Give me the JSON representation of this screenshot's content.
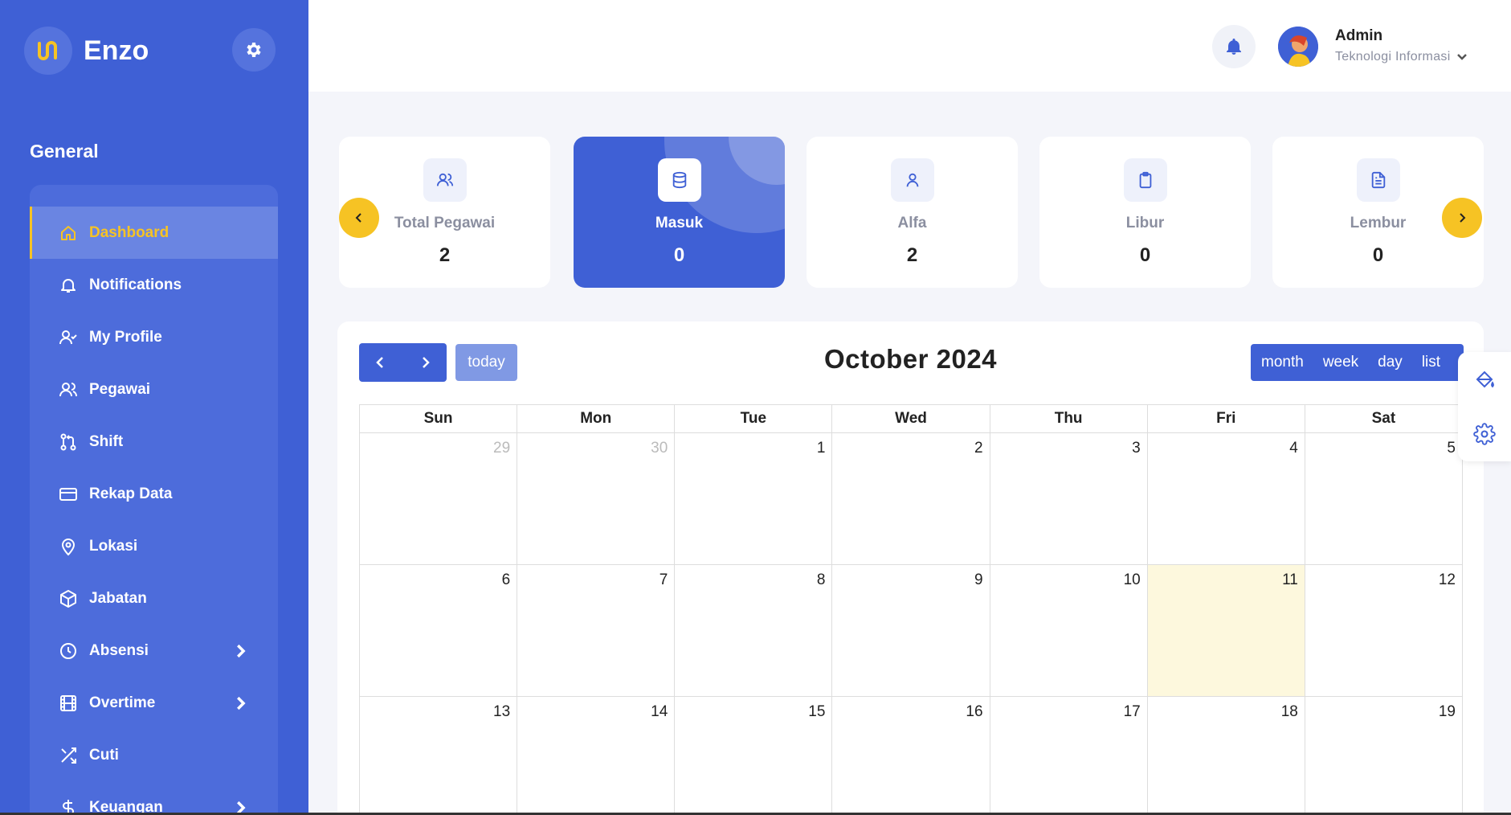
{
  "brand": {
    "name": "Enzo"
  },
  "sidebar": {
    "section_title": "General",
    "items": [
      {
        "label": "Dashboard",
        "icon": "home-icon",
        "active": true
      },
      {
        "label": "Notifications",
        "icon": "bell-icon"
      },
      {
        "label": "My Profile",
        "icon": "user-check-icon"
      },
      {
        "label": "Pegawai",
        "icon": "users-icon"
      },
      {
        "label": "Shift",
        "icon": "git-pull-icon"
      },
      {
        "label": "Rekap Data",
        "icon": "credit-card-icon"
      },
      {
        "label": "Lokasi",
        "icon": "map-pin-icon"
      },
      {
        "label": "Jabatan",
        "icon": "box-icon"
      },
      {
        "label": "Absensi",
        "icon": "clock-icon",
        "has_submenu": true
      },
      {
        "label": "Overtime",
        "icon": "film-icon",
        "has_submenu": true
      },
      {
        "label": "Cuti",
        "icon": "shuffle-icon"
      },
      {
        "label": "Keuangan",
        "icon": "dollar-icon",
        "has_submenu": true
      }
    ]
  },
  "header": {
    "user_name": "Admin",
    "user_dept": "Teknologi Informasi"
  },
  "stats": [
    {
      "label": "Total Pegawai",
      "value": "2",
      "icon": "users-icon"
    },
    {
      "label": "Masuk",
      "value": "0",
      "icon": "database-icon",
      "active": true
    },
    {
      "label": "Alfa",
      "value": "2",
      "icon": "user-icon"
    },
    {
      "label": "Libur",
      "value": "0",
      "icon": "clipboard-icon"
    },
    {
      "label": "Lembur",
      "value": "0",
      "icon": "file-text-icon"
    }
  ],
  "calendar": {
    "title": "October 2024",
    "today_label": "today",
    "views": [
      "month",
      "week",
      "day",
      "list"
    ],
    "weekdays": [
      "Sun",
      "Mon",
      "Tue",
      "Wed",
      "Thu",
      "Fri",
      "Sat"
    ],
    "weeks": [
      [
        {
          "d": "29",
          "other": true
        },
        {
          "d": "30",
          "other": true
        },
        {
          "d": "1"
        },
        {
          "d": "2"
        },
        {
          "d": "3"
        },
        {
          "d": "4"
        },
        {
          "d": "5"
        }
      ],
      [
        {
          "d": "6"
        },
        {
          "d": "7"
        },
        {
          "d": "8"
        },
        {
          "d": "9"
        },
        {
          "d": "10"
        },
        {
          "d": "11",
          "today": true
        },
        {
          "d": "12"
        }
      ],
      [
        {
          "d": "13"
        },
        {
          "d": "14"
        },
        {
          "d": "15"
        },
        {
          "d": "16"
        },
        {
          "d": "17"
        },
        {
          "d": "18"
        },
        {
          "d": "19"
        }
      ]
    ]
  },
  "colors": {
    "primary": "#3f60d5",
    "accent": "#f6c324",
    "today_bg": "#fdf8dd"
  }
}
